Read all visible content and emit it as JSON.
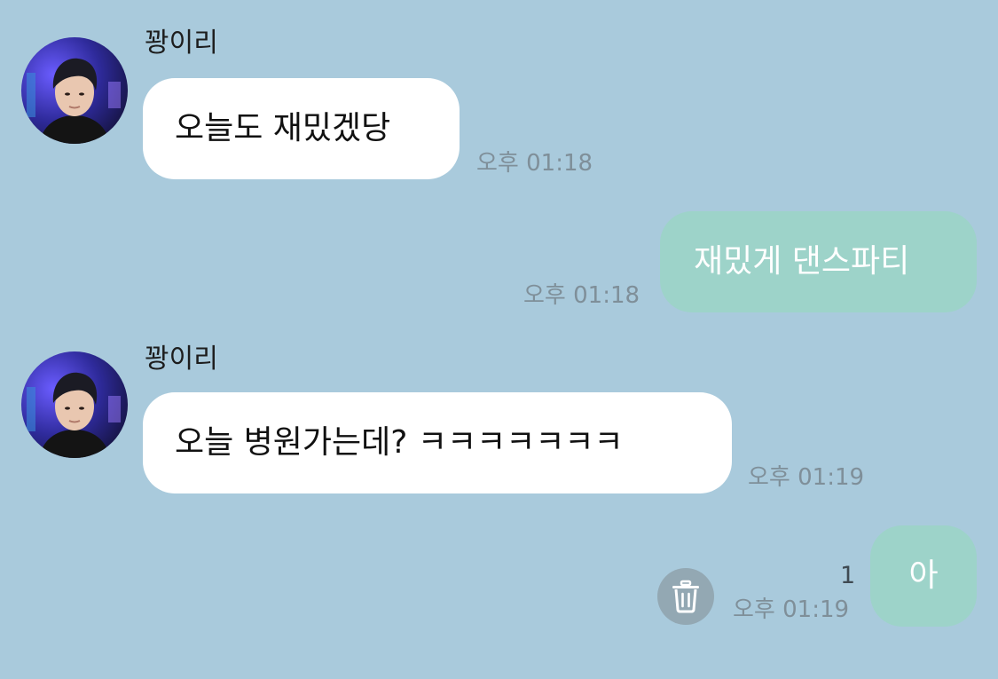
{
  "messages": [
    {
      "id": 1,
      "direction": "incoming",
      "sender": "꽝이리",
      "text": "오늘도 재밌겠당",
      "time": "오후 01:18"
    },
    {
      "id": 2,
      "direction": "outgoing",
      "text": "재밌게 댄스파티",
      "time": "오후 01:18"
    },
    {
      "id": 3,
      "direction": "incoming",
      "sender": "꽝이리",
      "text": "오늘 병원가는데? ㅋㅋㅋㅋㅋㅋㅋ",
      "time": "오후 01:19"
    },
    {
      "id": 4,
      "direction": "outgoing",
      "text": "아",
      "time": "오후 01:19",
      "unread_count": "1"
    }
  ],
  "icons": {
    "delete": "trash-icon",
    "profile": "profile-photo"
  },
  "colors": {
    "background": "#a9cadc",
    "incoming_bubble": "#ffffff",
    "outgoing_bubble": "#9dd3c9",
    "timestamp": "#7f8f99"
  }
}
